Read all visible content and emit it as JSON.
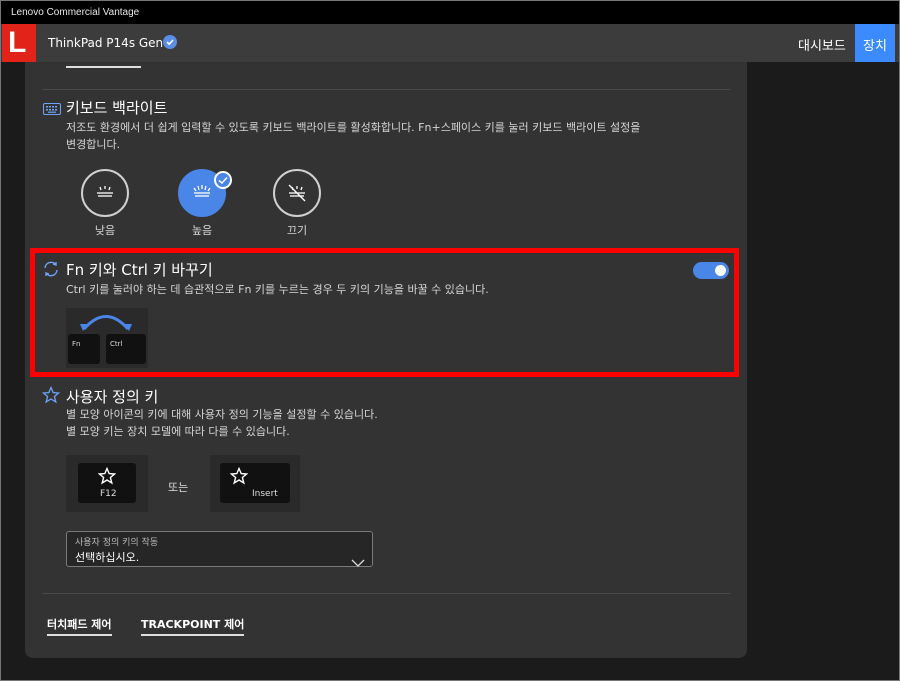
{
  "window": {
    "title": "Lenovo Commercial Vantage"
  },
  "header": {
    "logo": "L",
    "device_name": "ThinkPad P14s Gen 3",
    "nav": {
      "dashboard": "대시보드",
      "device": "장치"
    }
  },
  "backlight": {
    "title": "키보드 백라이트",
    "desc_line1": "저조도 환경에서 더 쉽게 입력할 수 있도록 키보드 백라이트를 활성화합니다. Fn+스페이스 키를 눌러 키보드 백라이트 설정을",
    "desc_line2": "변경합니다.",
    "options": [
      {
        "label": "낮음",
        "selected": false
      },
      {
        "label": "높음",
        "selected": true
      },
      {
        "label": "끄기",
        "selected": false
      }
    ]
  },
  "fn_ctrl": {
    "title": "Fn 키와 Ctrl 키 바꾸기",
    "desc": "Ctrl 키를 눌러야 하는 데 습관적으로 Fn 키를 누르는 경우 두 키의 기능을 바꿀 수 있습니다.",
    "toggle_on": true,
    "key_left": "Fn",
    "key_right": "Ctrl"
  },
  "custom_key": {
    "title": "사용자 정의 키",
    "desc_line1": "별 모양 아이콘의 키에 대해 사용자 정의 기능을 설정할 수 있습니다.",
    "desc_line2": "별 모양 키는 장치 모델에 따라 다를 수 있습니다.",
    "key1_label": "F12",
    "or": "또는",
    "key2_label": "Insert",
    "dropdown": {
      "caption": "사용자 정의 키의 작동",
      "value": "선택하십시오."
    }
  },
  "links": {
    "touchpad": "터치패드 제어",
    "trackpoint": "TRACKPOINT 제어"
  },
  "colors": {
    "accent": "#4a86e8",
    "highlight": "#ff0000",
    "logo": "#e2231a",
    "nav_active": "#3b8bff"
  }
}
